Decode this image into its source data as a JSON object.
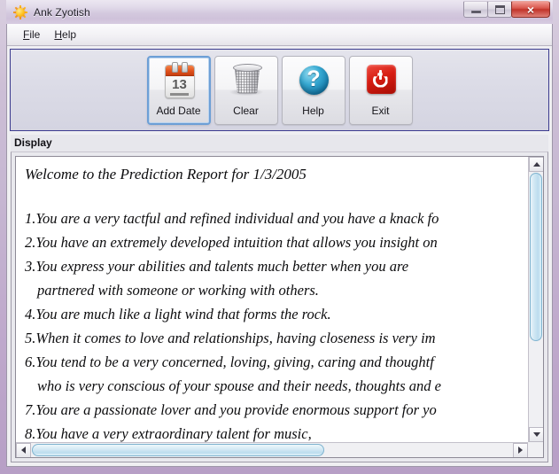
{
  "window": {
    "title": "Ank Zyotish",
    "icon": "sun-icon",
    "controls": {
      "minimize": "minimize-icon",
      "maximize": "maximize-icon",
      "close": "×"
    }
  },
  "menubar": {
    "items": [
      {
        "label": "File",
        "mnemonic": "F",
        "rest": "ile"
      },
      {
        "label": "Help",
        "mnemonic": "H",
        "rest": "elp"
      }
    ]
  },
  "toolbar": {
    "border_color": "#3b3a8e",
    "buttons": [
      {
        "label": "Add Date",
        "icon": "calendar-icon",
        "calendar_day": "13",
        "focused": true
      },
      {
        "label": "Clear",
        "icon": "trash-can-icon",
        "focused": false
      },
      {
        "label": "Help",
        "icon": "question-mark-icon",
        "glyph": "?",
        "focused": false
      },
      {
        "label": "Exit",
        "icon": "power-button-icon",
        "focused": false
      }
    ]
  },
  "display": {
    "group_label": "Display",
    "report": {
      "heading": "Welcome to the Prediction Report for 1/3/2005",
      "date": "1/3/2005",
      "lines": [
        {
          "text": "1.You are a very tactful and refined individual and you have a knack fo",
          "continuation": false
        },
        {
          "text": "2.You have an extremely developed intuition that allows you insight on",
          "continuation": false
        },
        {
          "text": "3.You express your abilities and talents much better when you are",
          "continuation": false
        },
        {
          "text": "partnered with someone or working with others.",
          "continuation": true
        },
        {
          "text": "4.You are much like a light wind that forms the rock.",
          "continuation": false
        },
        {
          "text": "5.When it comes to love and relationships, having closeness is very im",
          "continuation": false
        },
        {
          "text": "6.You tend to be a very concerned, loving, giving, caring and thoughtf",
          "continuation": false
        },
        {
          "text": "who is very conscious of your spouse and their needs, thoughts and e",
          "continuation": true
        },
        {
          "text": "7.You are a passionate lover and you provide enormous support for yo",
          "continuation": false
        },
        {
          "text": "8.You have a very extraordinary talent for music,",
          "continuation": false
        }
      ]
    },
    "scrollbars": {
      "vertical": {
        "up": "scroll-up-icon",
        "down": "scroll-down-icon"
      },
      "horizontal": {
        "left": "scroll-left-icon",
        "right": "scroll-right-icon"
      },
      "thumb_color": "#bcdcee"
    }
  }
}
